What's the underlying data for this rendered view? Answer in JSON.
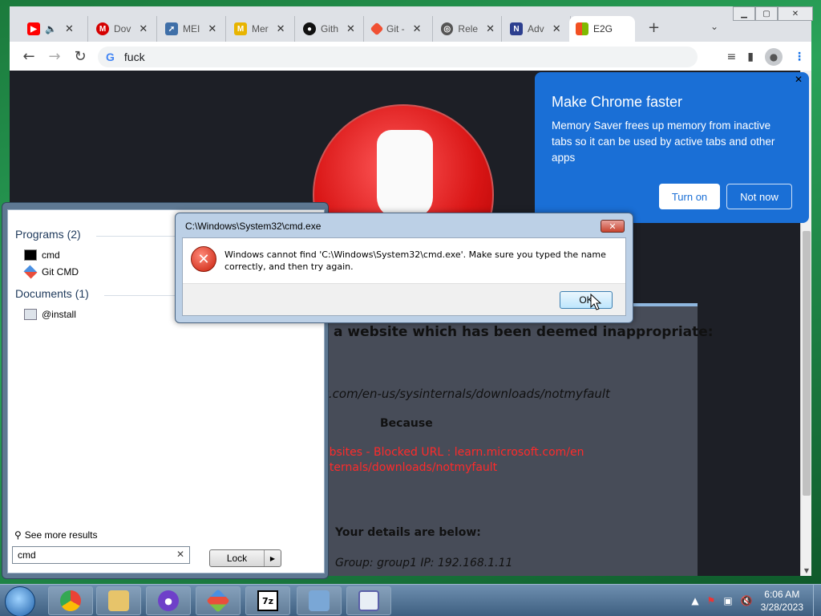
{
  "browser": {
    "tabs": [
      {
        "label": "",
        "icon": "youtube-icon",
        "color": "#ff0000"
      },
      {
        "label": "Dov",
        "icon": "m-icon",
        "color": "#d50000"
      },
      {
        "label": "MEI",
        "icon": "rocket-icon",
        "color": "#3f6fa8"
      },
      {
        "label": "Mer",
        "icon": "md-icon",
        "color": "#e8b400"
      },
      {
        "label": "Gith",
        "icon": "github-icon",
        "color": "#111111"
      },
      {
        "label": "Git -",
        "icon": "git-icon",
        "color": "#f05033"
      },
      {
        "label": "Rele",
        "icon": "globe-icon",
        "color": "#555555"
      },
      {
        "label": "Adv",
        "icon": "n-icon",
        "color": "#2d3f8f"
      },
      {
        "label": "E2G",
        "icon": "windows-icon",
        "color": "#00a4ef"
      }
    ],
    "new_tab": "+",
    "address": "fuck"
  },
  "memory_saver": {
    "title": "Make Chrome faster",
    "body": "Memory Saver frees up memory from inactive tabs so it can be used by active tabs and other apps",
    "turn_on": "Turn on",
    "not_now": "Not now"
  },
  "block_page": {
    "line1": "a website which has been deemed inappropriate:",
    "url": "t.com/en-us/sysinternals/downloads/notmyfault",
    "because": "Because",
    "reason1": "ebsites - Blocked URL : learn.microsoft.com/en",
    "reason2": "nternals/downloads/notmyfault",
    "details": "Your details are below:",
    "group_ip": "Group: group1   IP: 192.168.1.11"
  },
  "start_menu": {
    "programs_header": "Programs (2)",
    "programs": [
      "cmd",
      "Git CMD"
    ],
    "documents_header": "Documents (1)",
    "documents": [
      "@install"
    ],
    "see_more": "See more results",
    "search_value": "cmd",
    "lock_label": "Lock"
  },
  "error_dialog": {
    "title": "C:\\Windows\\System32\\cmd.exe",
    "message": "Windows cannot find 'C:\\Windows\\System32\\cmd.exe'. Make sure you typed the name correctly, and then try again.",
    "ok": "OK"
  },
  "taskbar": {
    "time": "6:06 AM",
    "date": "3/28/2023"
  },
  "colors": {
    "chrome_blue": "#1a6fd6",
    "block_red": "#ff2a2a"
  }
}
